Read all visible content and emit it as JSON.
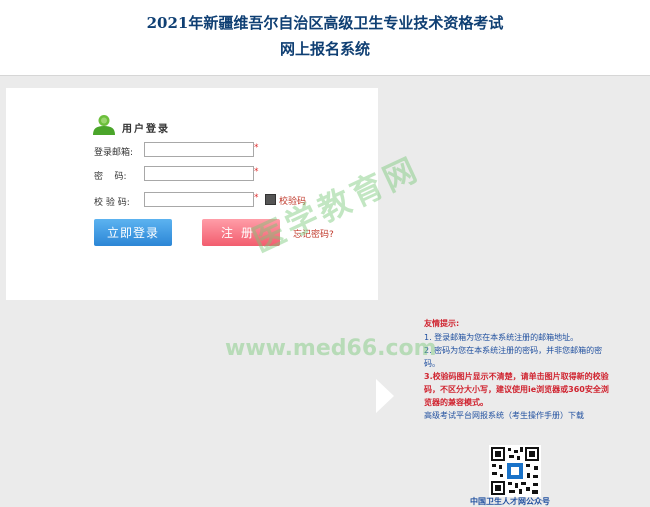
{
  "header": {
    "title_line1": "2021年新疆维吾尔自治区高级卫生专业技术资格考试",
    "title_line2": "网上报名系统"
  },
  "login": {
    "title": "用户登录",
    "email_label": "登录邮箱:",
    "password_label": "密    码:",
    "captcha_label": "校 验 码:",
    "required_mark": "*",
    "captcha_link": "校验码",
    "login_button": "立即登录",
    "register_button": "注册",
    "forgot_link": "忘记密码?"
  },
  "tips": {
    "title": "友情提示:",
    "item1": "1. 登录邮箱为您在本系统注册的邮箱地址。",
    "item2": "2. 密码为您在本系统注册的密码，并非您邮箱的密码。",
    "item3": "3.校验码图片显示不清楚，请单击图片取得新的校验码，不区分大小写，建议使用ie浏览器或360安全浏览器的兼容模式。",
    "manual": "高级考试平台网报系统（考生操作手册）下载"
  },
  "qr_caption": "中国卫生人才网公众号",
  "watermark": {
    "text": "医学教育网",
    "url": "www.med66.com"
  },
  "colors": {
    "title": "#0f3f73",
    "login_button": "#2c86d6",
    "register_button": "#f25d6e",
    "tip_red": "#d0232f",
    "tip_blue": "#1f4f9f"
  }
}
